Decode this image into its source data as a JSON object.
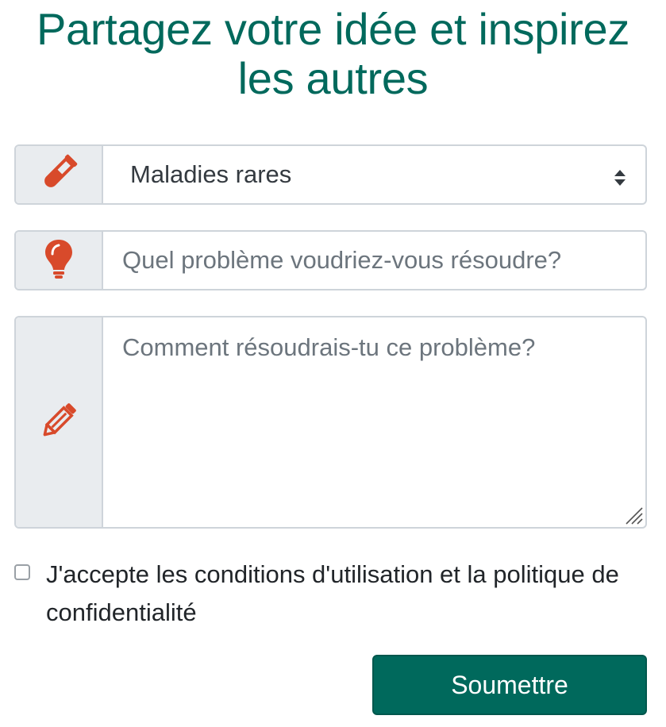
{
  "heading": {
    "line1": "Partagez votre idée et inspirez",
    "line2": "les autres"
  },
  "category_select": {
    "icon": "test-tube-icon",
    "selected": "Maladies rares"
  },
  "problem_input": {
    "icon": "lightbulb-icon",
    "value": "",
    "placeholder": "Quel problème voudriez-vous résoudre?"
  },
  "solution_textarea": {
    "icon": "pencil-icon",
    "value": "",
    "placeholder": "Comment résoudrais-tu ce problème?"
  },
  "terms": {
    "checked": false,
    "label": "J'accepte les conditions d'utilisation et la politique de confidentialité"
  },
  "submit": {
    "label": "Soumettre"
  },
  "colors": {
    "brand": "#00695c",
    "icon_accent": "#d84a2b",
    "addon_bg": "#e9ecef"
  }
}
